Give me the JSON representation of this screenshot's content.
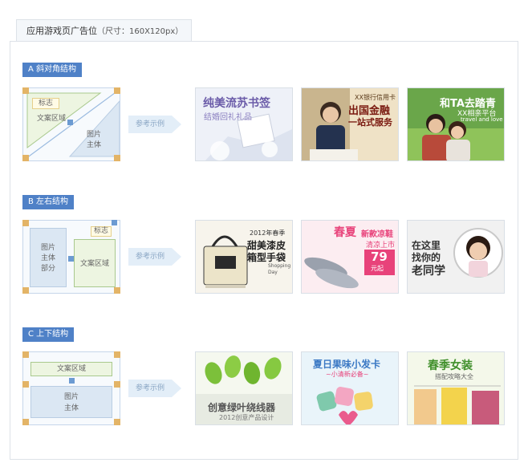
{
  "header": {
    "tab_title": "应用游戏页广告位",
    "tab_dims": "（尺寸：160X120px）"
  },
  "arrow_label": "参考示例",
  "sections": [
    {
      "label": "A 斜对角结构",
      "diagram": {
        "logo": "标志",
        "copy": "文案区域",
        "image": "图片",
        "image2": "主体"
      },
      "examples": [
        {
          "title": "纯美流苏书签",
          "sub": "结婚回礼礼品"
        },
        {
          "tag": "XX银行信用卡",
          "title": "出国金融",
          "sub": "一站式服务"
        },
        {
          "title": "和TA去踏青",
          "sub": "XX相亲平台",
          "sub2": "travel and love"
        }
      ]
    },
    {
      "label": "B 左右结构",
      "diagram": {
        "logo": "标志",
        "image": "图片",
        "image2": "主体",
        "image3": "部分",
        "copy": "文案区域"
      },
      "examples": [
        {
          "tag": "2012年春季",
          "title": "甜美漆皮",
          "title2": "箱型手袋",
          "sub": "Shopping",
          "sub2": "Day"
        },
        {
          "title": "春夏",
          "title_b": "新款凉鞋",
          "sub": "清凉上市",
          "price": "79",
          "price_unit": "元起"
        },
        {
          "title": "在这里",
          "title2": "找你的",
          "title3": "老同学"
        }
      ]
    },
    {
      "label": "C 上下结构",
      "diagram": {
        "copy": "文案区域",
        "image": "图片",
        "image2": "主体"
      },
      "examples": [
        {
          "title": "创意绿叶绕线器",
          "sub": "2012创意产品设计"
        },
        {
          "title": "夏日果味小发卡",
          "sub": "~小清新必备~"
        },
        {
          "title": "春季女装",
          "sub": "搭配攻略大全"
        }
      ]
    }
  ]
}
